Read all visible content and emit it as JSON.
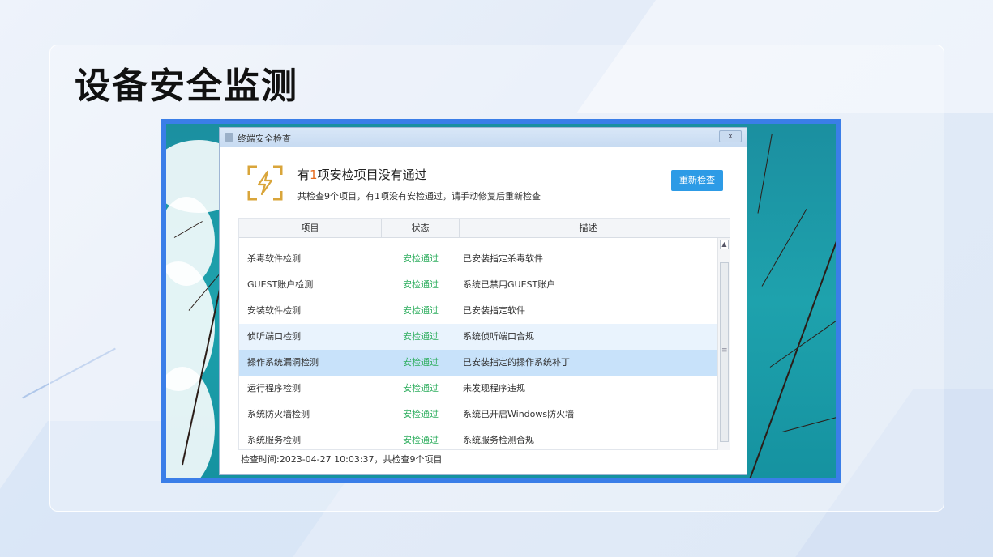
{
  "slide": {
    "title": "设备安全监测"
  },
  "window": {
    "title": "终端安全检查",
    "close_label": "x",
    "headline_prefix": "有",
    "headline_count": "1",
    "headline_suffix": "项安检项目没有通过",
    "subline": "共检查9个项目，有1项没有安检通过，请手动修复后重新检查",
    "recheck_label": "重新检查",
    "table": {
      "headers": [
        "项目",
        "状态",
        "描述"
      ],
      "rows": [
        {
          "item": "杀毒软件检测",
          "status": "安检通过",
          "desc": "已安装指定杀毒软件"
        },
        {
          "item": "GUEST账户检测",
          "status": "安检通过",
          "desc": "系统已禁用GUEST账户"
        },
        {
          "item": "安装软件检测",
          "status": "安检通过",
          "desc": "已安装指定软件"
        },
        {
          "item": "侦听端口检测",
          "status": "安检通过",
          "desc": "系统侦听端口合规"
        },
        {
          "item": "操作系统漏洞检测",
          "status": "安检通过",
          "desc": "已安装指定的操作系统补丁"
        },
        {
          "item": "运行程序检测",
          "status": "安检通过",
          "desc": "未发现程序违规"
        },
        {
          "item": "系统防火墙检测",
          "status": "安检通过",
          "desc": "系统已开启Windows防火墙"
        },
        {
          "item": "系统服务检测",
          "status": "安检通过",
          "desc": "系统服务检测合规"
        }
      ]
    },
    "footer": "检查时间:2023-04-27 10:03:37，共检查9个项目"
  },
  "colors": {
    "accent_blue": "#2d9be6",
    "pass_green": "#2fae5f",
    "warn_orange": "#e66a1c",
    "frame_blue": "#3a7ee8",
    "icon_gold": "#d9a53a"
  },
  "icons": {
    "warning": "lightning-bracket-icon",
    "close": "close-icon",
    "scroll_up": "chevron-up-icon"
  }
}
